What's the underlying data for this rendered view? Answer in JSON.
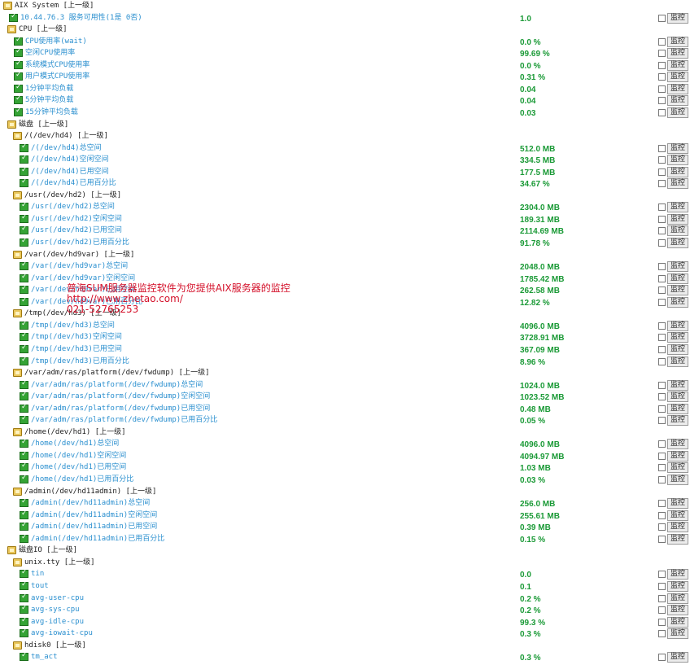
{
  "rows": [
    {
      "type": "group",
      "level": 0,
      "label": "AIX System [上一级]"
    },
    {
      "type": "metric",
      "level": 0,
      "label": "10.44.76.3 服务可用性(1是 0否)",
      "value": "1.0"
    },
    {
      "type": "group",
      "level": 0,
      "label": "CPU [上一级]"
    },
    {
      "type": "metric",
      "level": 1,
      "label": "CPU使用率(wait)",
      "value": "0.0 %"
    },
    {
      "type": "metric",
      "level": 1,
      "label": "空闲CPU使用率",
      "value": "99.69 %"
    },
    {
      "type": "metric",
      "level": 1,
      "label": "系统模式CPU使用率",
      "value": "0.0 %"
    },
    {
      "type": "metric",
      "level": 1,
      "label": "用户模式CPU使用率",
      "value": "0.31 %"
    },
    {
      "type": "metric",
      "level": 1,
      "label": "1分钟平均负载",
      "value": "0.04"
    },
    {
      "type": "metric",
      "level": 1,
      "label": "5分钟平均负载",
      "value": "0.04"
    },
    {
      "type": "metric",
      "level": 1,
      "label": "15分钟平均负载",
      "value": "0.03"
    },
    {
      "type": "group",
      "level": 0,
      "label": "磁盘 [上一级]"
    },
    {
      "type": "group",
      "level": 1,
      "label": "/(/dev/hd4) [上一级]"
    },
    {
      "type": "metric",
      "level": 2,
      "label": "/(/dev/hd4)总空间",
      "value": "512.0 MB"
    },
    {
      "type": "metric",
      "level": 2,
      "label": "/(/dev/hd4)空闲空间",
      "value": "334.5 MB"
    },
    {
      "type": "metric",
      "level": 2,
      "label": "/(/dev/hd4)已用空间",
      "value": "177.5 MB"
    },
    {
      "type": "metric",
      "level": 2,
      "label": "/(/dev/hd4)已用百分比",
      "value": "34.67 %"
    },
    {
      "type": "group",
      "level": 1,
      "label": "/usr(/dev/hd2) [上一级]"
    },
    {
      "type": "metric",
      "level": 2,
      "label": "/usr(/dev/hd2)总空间",
      "value": "2304.0 MB"
    },
    {
      "type": "metric",
      "level": 2,
      "label": "/usr(/dev/hd2)空闲空间",
      "value": "189.31 MB"
    },
    {
      "type": "metric",
      "level": 2,
      "label": "/usr(/dev/hd2)已用空间",
      "value": "2114.69 MB"
    },
    {
      "type": "metric",
      "level": 2,
      "label": "/usr(/dev/hd2)已用百分比",
      "value": "91.78 %"
    },
    {
      "type": "group",
      "level": 1,
      "label": "/var(/dev/hd9var) [上一级]"
    },
    {
      "type": "metric",
      "level": 2,
      "label": "/var(/dev/hd9var)总空间",
      "value": "2048.0 MB"
    },
    {
      "type": "metric",
      "level": 2,
      "label": "/var(/dev/hd9var)空闲空间",
      "value": "1785.42 MB"
    },
    {
      "type": "metric",
      "level": 2,
      "label": "/var(/dev/hd9var)已用空间",
      "value": "262.58 MB"
    },
    {
      "type": "metric",
      "level": 2,
      "label": "/var(/dev/hd9var)已用百分比",
      "value": "12.82 %"
    },
    {
      "type": "group",
      "level": 1,
      "label": "/tmp(/dev/hd3) [上一级]"
    },
    {
      "type": "metric",
      "level": 2,
      "label": "/tmp(/dev/hd3)总空间",
      "value": "4096.0 MB"
    },
    {
      "type": "metric",
      "level": 2,
      "label": "/tmp(/dev/hd3)空闲空间",
      "value": "3728.91 MB"
    },
    {
      "type": "metric",
      "level": 2,
      "label": "/tmp(/dev/hd3)已用空间",
      "value": "367.09 MB"
    },
    {
      "type": "metric",
      "level": 2,
      "label": "/tmp(/dev/hd3)已用百分比",
      "value": "8.96 %"
    },
    {
      "type": "group",
      "level": 1,
      "label": "/var/adm/ras/platform(/dev/fwdump) [上一级]"
    },
    {
      "type": "metric",
      "level": 2,
      "label": "/var/adm/ras/platform(/dev/fwdump)总空间",
      "value": "1024.0 MB"
    },
    {
      "type": "metric",
      "level": 2,
      "label": "/var/adm/ras/platform(/dev/fwdump)空闲空间",
      "value": "1023.52 MB"
    },
    {
      "type": "metric",
      "level": 2,
      "label": "/var/adm/ras/platform(/dev/fwdump)已用空间",
      "value": "0.48 MB"
    },
    {
      "type": "metric",
      "level": 2,
      "label": "/var/adm/ras/platform(/dev/fwdump)已用百分比",
      "value": "0.05 %"
    },
    {
      "type": "group",
      "level": 1,
      "label": "/home(/dev/hd1) [上一级]"
    },
    {
      "type": "metric",
      "level": 2,
      "label": "/home(/dev/hd1)总空间",
      "value": "4096.0 MB"
    },
    {
      "type": "metric",
      "level": 2,
      "label": "/home(/dev/hd1)空闲空间",
      "value": "4094.97 MB"
    },
    {
      "type": "metric",
      "level": 2,
      "label": "/home(/dev/hd1)已用空间",
      "value": "1.03 MB"
    },
    {
      "type": "metric",
      "level": 2,
      "label": "/home(/dev/hd1)已用百分比",
      "value": "0.03 %"
    },
    {
      "type": "group",
      "level": 1,
      "label": "/admin(/dev/hd11admin) [上一级]"
    },
    {
      "type": "metric",
      "level": 2,
      "label": "/admin(/dev/hd11admin)总空间",
      "value": "256.0 MB"
    },
    {
      "type": "metric",
      "level": 2,
      "label": "/admin(/dev/hd11admin)空闲空间",
      "value": "255.61 MB"
    },
    {
      "type": "metric",
      "level": 2,
      "label": "/admin(/dev/hd11admin)已用空间",
      "value": "0.39 MB"
    },
    {
      "type": "metric",
      "level": 2,
      "label": "/admin(/dev/hd11admin)已用百分比",
      "value": "0.15 %"
    },
    {
      "type": "group",
      "level": 0,
      "label": "磁盘IO [上一级]"
    },
    {
      "type": "group",
      "level": 1,
      "label": "unix.tty [上一级]"
    },
    {
      "type": "metric",
      "level": 2,
      "label": "tin",
      "value": "0.0"
    },
    {
      "type": "metric",
      "level": 2,
      "label": "tout",
      "value": "0.1"
    },
    {
      "type": "metric",
      "level": 2,
      "label": "avg-user-cpu",
      "value": "0.2 %"
    },
    {
      "type": "metric",
      "level": 2,
      "label": "avg-sys-cpu",
      "value": "0.2 %"
    },
    {
      "type": "metric",
      "level": 2,
      "label": "avg-idle-cpu",
      "value": "99.3 %"
    },
    {
      "type": "metric",
      "level": 2,
      "label": "avg-iowait-cpu",
      "value": "0.3 %"
    },
    {
      "type": "group",
      "level": 1,
      "label": "hdisk0 [上一级]"
    },
    {
      "type": "metric",
      "level": 2,
      "label": "tm_act",
      "value": "0.3 %"
    }
  ],
  "monitor_label": "监控",
  "watermark": {
    "line1": "普海SUM服务器监控软件为您提供AIX服务器的监控",
    "line2": "http://www.zhetao.com/",
    "line3": "021-52765253"
  }
}
